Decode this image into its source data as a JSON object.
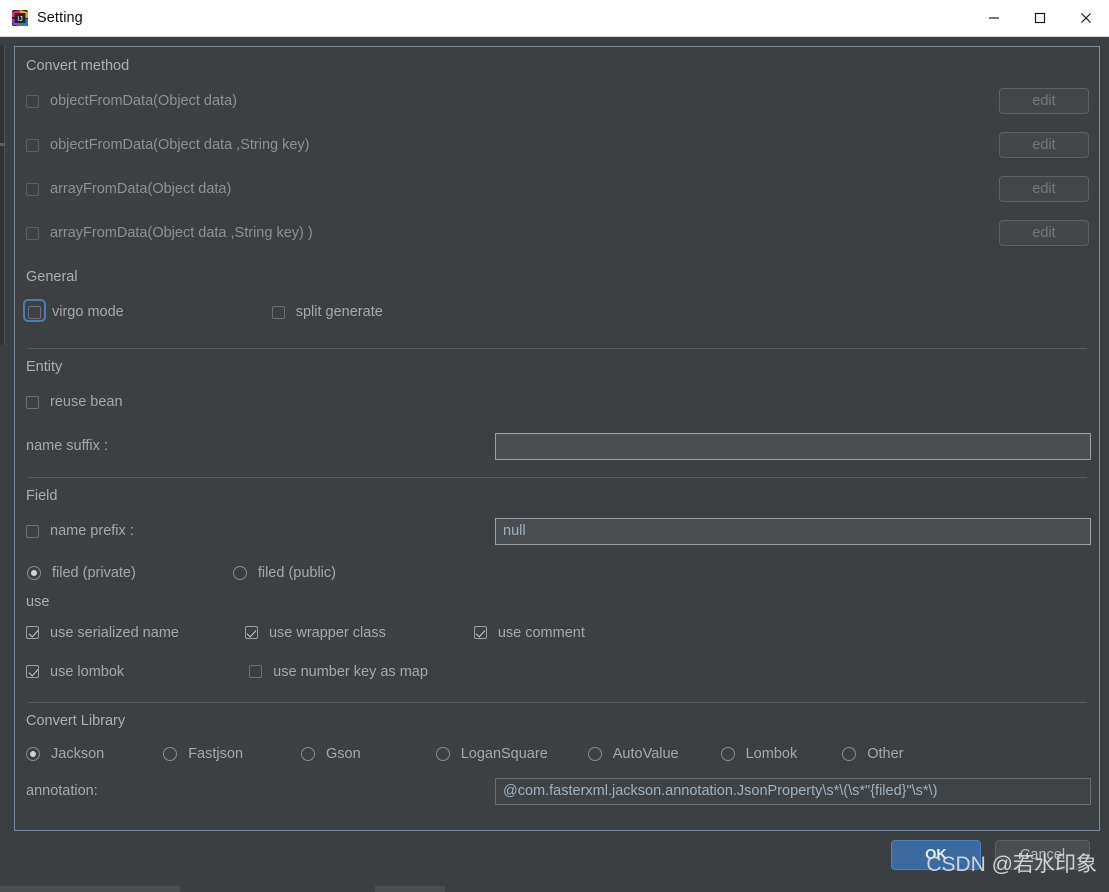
{
  "window": {
    "title": "Setting",
    "icon": "intellij-idea-icon",
    "controls": {
      "minimize": "minimize-icon",
      "maximize": "maximize-icon",
      "close": "close-icon"
    }
  },
  "convert_method": {
    "title": "Convert method",
    "items": [
      {
        "label": "objectFromData(Object data)",
        "checked": false,
        "edit_label": "edit"
      },
      {
        "label": "objectFromData(Object data ,String key)",
        "checked": false,
        "edit_label": "edit"
      },
      {
        "label": "arrayFromData(Object data)",
        "checked": false,
        "edit_label": "edit"
      },
      {
        "label": "arrayFromData(Object data ,String key) )",
        "checked": false,
        "edit_label": "edit"
      }
    ]
  },
  "general": {
    "title": "General",
    "virgo_mode": {
      "label": "virgo mode",
      "checked": false,
      "focused": true
    },
    "split_generate": {
      "label": "split generate",
      "checked": false
    }
  },
  "entity": {
    "title": "Entity",
    "reuse_bean": {
      "label": "reuse bean",
      "checked": false
    },
    "name_suffix": {
      "label": "name suffix :",
      "value": "",
      "placeholder": ""
    }
  },
  "field": {
    "title": "Field",
    "name_prefix": {
      "label": "name prefix :",
      "checked": false,
      "value": "null"
    },
    "visibility": {
      "options": [
        {
          "label": "filed (private)",
          "selected": true
        },
        {
          "label": "filed (public)",
          "selected": false
        }
      ]
    },
    "use": {
      "title": "use",
      "items": [
        {
          "label": "use serialized name",
          "checked": true
        },
        {
          "label": "use wrapper class",
          "checked": true
        },
        {
          "label": "use comment",
          "checked": true
        },
        {
          "label": "use lombok",
          "checked": true
        },
        {
          "label": "use number key as map",
          "checked": false
        }
      ]
    }
  },
  "convert_library": {
    "title": "Convert Library",
    "options": [
      {
        "label": "Jackson",
        "selected": true
      },
      {
        "label": "Fastjson",
        "selected": false
      },
      {
        "label": "Gson",
        "selected": false
      },
      {
        "label": "LoganSquare",
        "selected": false
      },
      {
        "label": "AutoValue",
        "selected": false
      },
      {
        "label": "Lombok",
        "selected": false
      },
      {
        "label": "Other",
        "selected": false
      }
    ],
    "annotation": {
      "label": "annotation:",
      "value": "@com.fasterxml.jackson.annotation.JsonProperty\\s*\\(\\s*\"{filed}\"\\s*\\)"
    }
  },
  "footer": {
    "ok_label": "OK",
    "cancel_label": "Cancel",
    "watermark": "CSDN @若水印象"
  },
  "colors": {
    "accent": "#3c6a9e",
    "panel_bg": "#3c4042",
    "window_bg": "#3c3f41",
    "text": "#a2a9ae",
    "field_text": "#9fb0c0"
  }
}
